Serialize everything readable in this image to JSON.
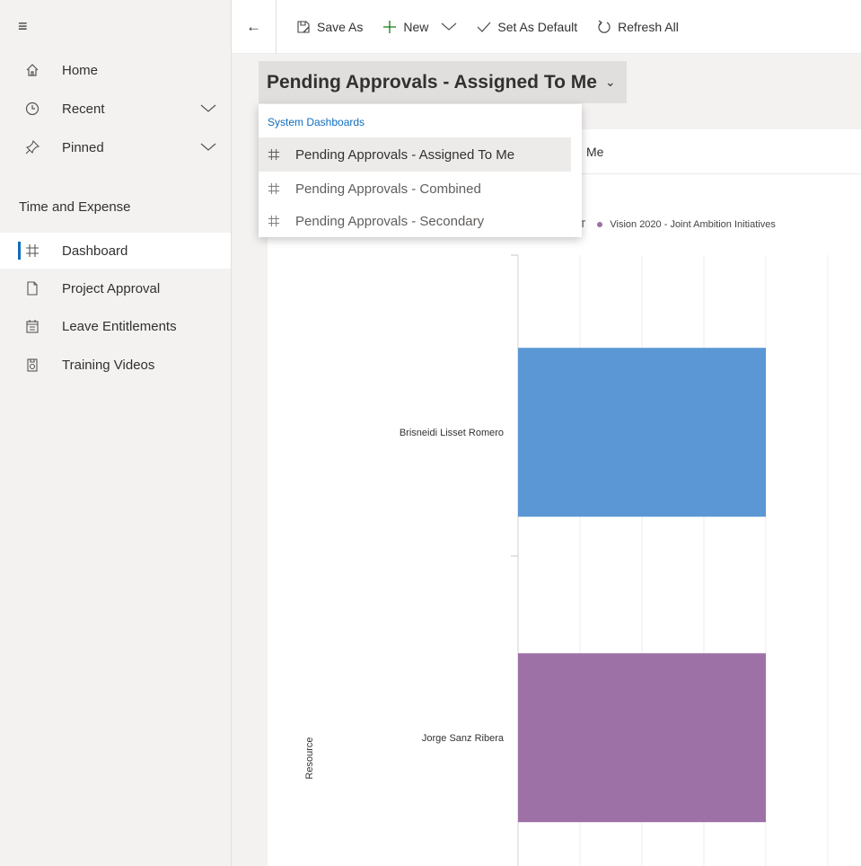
{
  "sidebar": {
    "menu_icon": "hamburger-menu-icon",
    "items": [
      {
        "label": "Home",
        "icon": "home-icon"
      },
      {
        "label": "Recent",
        "icon": "clock-icon",
        "chevron": "chevron-down-icon"
      },
      {
        "label": "Pinned",
        "icon": "pin-icon",
        "chevron": "chevron-down-icon"
      }
    ],
    "section_title": "Time and Expense",
    "section_items": [
      {
        "label": "Dashboard",
        "icon": "dashboard-icon",
        "active": true
      },
      {
        "label": "Project Approval",
        "icon": "document-icon"
      },
      {
        "label": "Leave Entitlements",
        "icon": "calendar-icon"
      },
      {
        "label": "Training Videos",
        "icon": "video-icon"
      }
    ]
  },
  "toolbar": {
    "back_icon": "back-arrow-icon",
    "save_as_label": "Save As",
    "new_label": "New",
    "set_default_label": "Set As Default",
    "refresh_label": "Refresh All"
  },
  "dashboard": {
    "title": "Pending Approvals - Assigned To Me"
  },
  "dropdown": {
    "header": "System Dashboards",
    "items": [
      {
        "label": "Pending Approvals - Assigned To Me",
        "selected": true
      },
      {
        "label": "Pending Approvals - Combined",
        "selected": false
      },
      {
        "label": "Pending Approvals - Secondary",
        "selected": false
      }
    ]
  },
  "chart_card": {
    "title_visible": "Me",
    "legend_visible_fragment": "r ICT",
    "legend_second": "Vision 2020 - Joint Ambition Initiatives"
  },
  "chart_data": {
    "type": "bar",
    "orientation": "horizontal",
    "ylabel": "Resource",
    "categories": [
      "Brisneidi Lisset Romero",
      "Jorge Sanz Ribera"
    ],
    "series": [
      {
        "name": "r ICT",
        "color": "#5b97d5",
        "values": [
          1,
          0
        ]
      },
      {
        "name": "Vision 2020 - Joint Ambition Initiatives",
        "color": "#9e71a6",
        "values": [
          0,
          1
        ]
      }
    ],
    "grid": true
  }
}
